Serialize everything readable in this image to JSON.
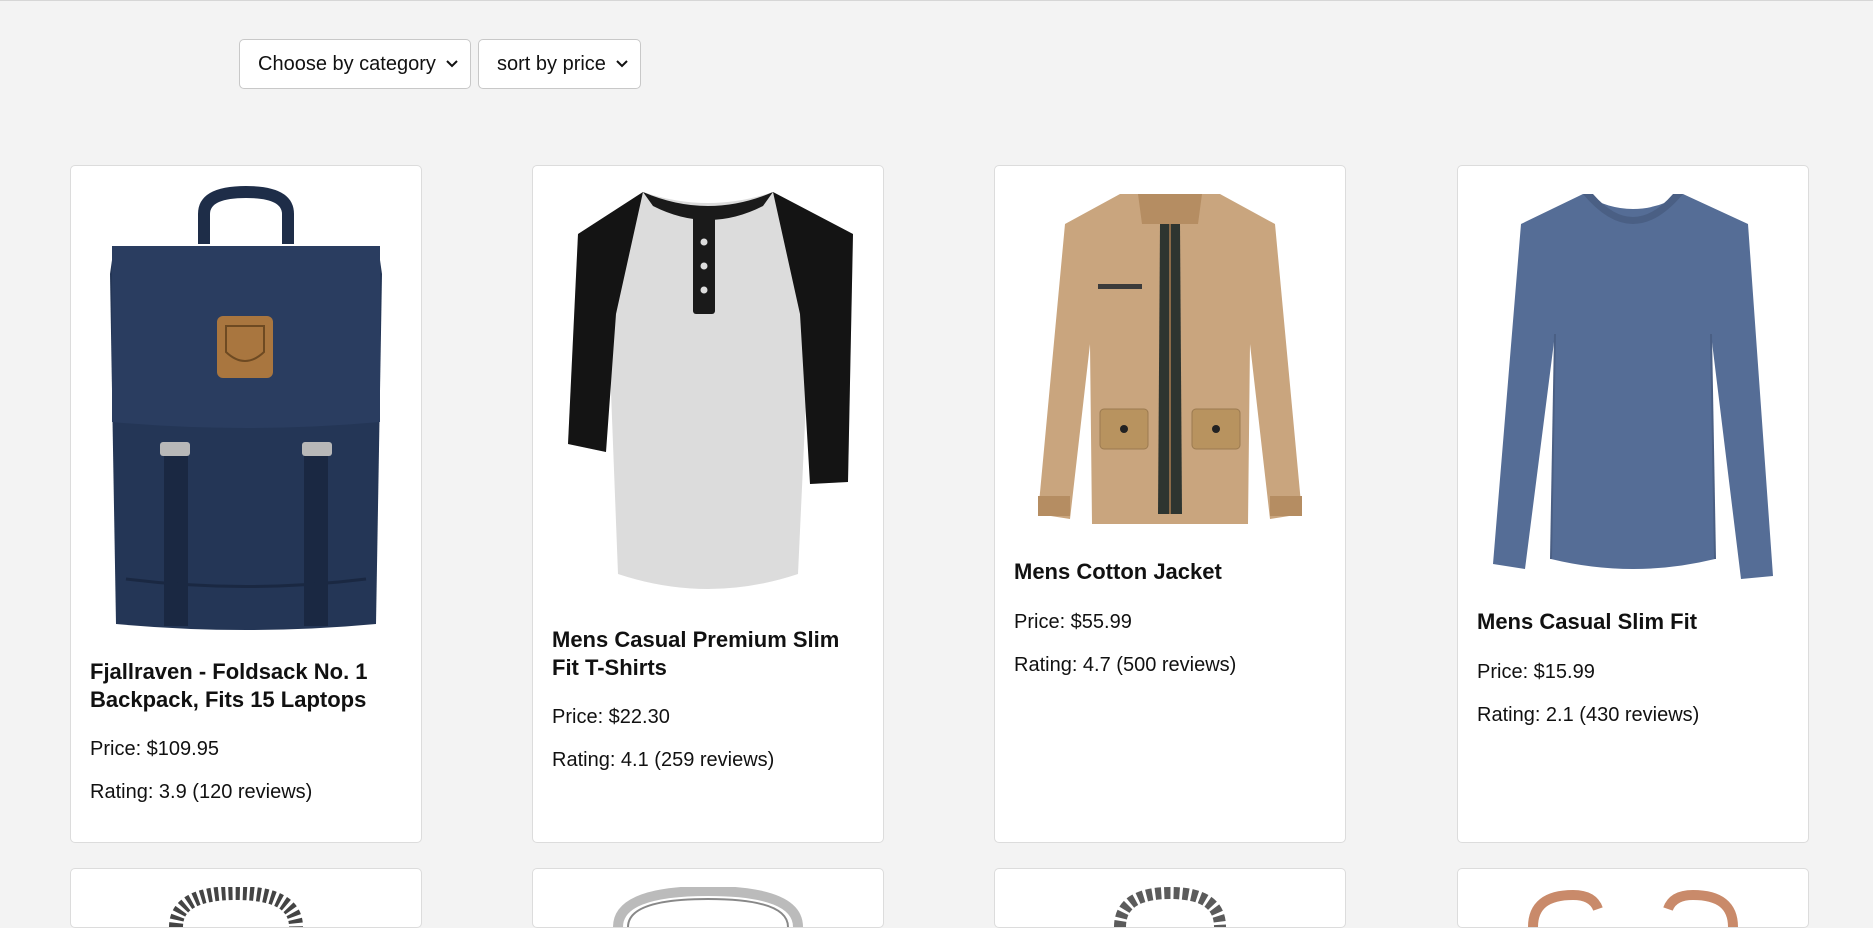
{
  "filters": {
    "category_label": "Choose by category",
    "price_label": "sort by price"
  },
  "products": [
    {
      "title": "Fjallraven - Foldsack No. 1 Backpack, Fits 15 Laptops",
      "price": "Price: $109.95",
      "rating": "Rating: 3.9 (120 reviews)",
      "icon": "backpack-image"
    },
    {
      "title": "Mens Casual Premium Slim Fit T-Shirts",
      "price": "Price: $22.30",
      "rating": "Rating: 4.1 (259 reviews)",
      "icon": "tshirt-image"
    },
    {
      "title": "Mens Cotton Jacket",
      "price": "Price: $55.99",
      "rating": "Rating: 4.7 (500 reviews)",
      "icon": "jacket-image"
    },
    {
      "title": "Mens Casual Slim Fit",
      "price": "Price: $15.99",
      "rating": "Rating: 2.1 (430 reviews)",
      "icon": "longsleeve-image"
    }
  ],
  "colors": {
    "background": "#f3f3f3",
    "card": "#ffffff",
    "backpack": "#243656",
    "jacket": "#c9a57e",
    "shirt_blue": "#556d96"
  }
}
